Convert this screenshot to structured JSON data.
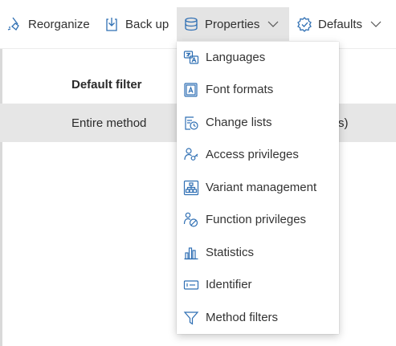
{
  "toolbar": {
    "reorganize_label": "Reorganize",
    "backup_label": "Back up",
    "properties_label": "Properties",
    "defaults_label": "Defaults"
  },
  "table": {
    "header_first": "Default filter",
    "selected_row_first": "Entire method",
    "selected_row_fragment": "s)"
  },
  "properties_menu": {
    "items": [
      {
        "label": "Languages",
        "icon": "languages-icon"
      },
      {
        "label": "Font formats",
        "icon": "font-formats-icon"
      },
      {
        "label": "Change lists",
        "icon": "change-lists-icon"
      },
      {
        "label": "Access privileges",
        "icon": "access-privileges-icon"
      },
      {
        "label": "Variant management",
        "icon": "variant-management-icon"
      },
      {
        "label": "Function privileges",
        "icon": "function-privileges-icon"
      },
      {
        "label": "Statistics",
        "icon": "statistics-icon"
      },
      {
        "label": "Identifier",
        "icon": "identifier-icon"
      },
      {
        "label": "Method filters",
        "icon": "method-filters-icon"
      }
    ]
  },
  "colors": {
    "icon_blue": "#2f6fb3",
    "active_button_bg": "#e4e4e4",
    "selected_row_bg": "#e6e6e6"
  }
}
